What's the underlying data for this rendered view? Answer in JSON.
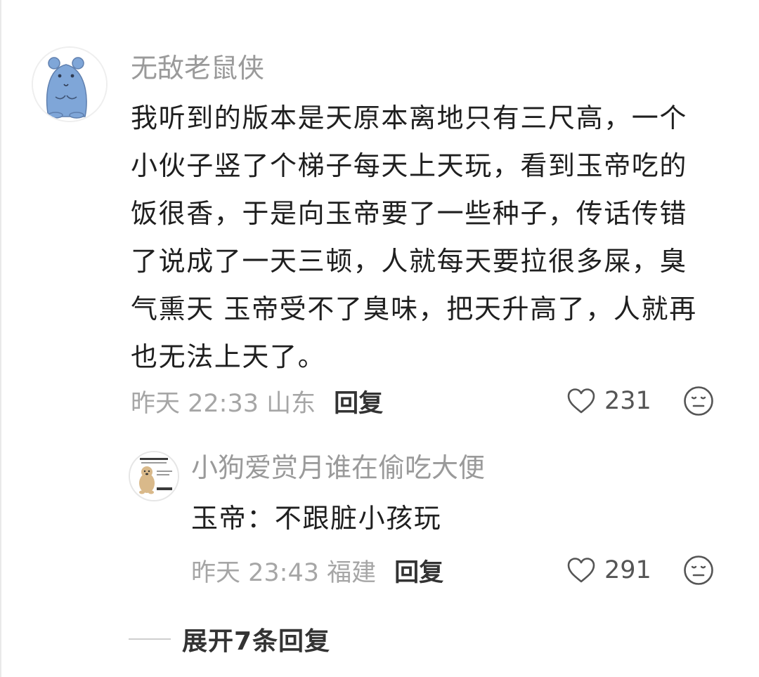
{
  "comment": {
    "username": "无敌老鼠侠",
    "avatar_icon": "mouse-avatar",
    "text": "我听到的版本是天原本离地只有三尺高，一个\n小伙子竖了个梯子每天上天玩，看到玉帝吃的\n饭很香，于是向玉帝要了一些种子，传话传错\n了说成了一天三顿，人就每天要拉很多屎，臭\n气熏天 玉帝受不了臭味，把天升高了，人就再\n也无法上天了。",
    "time_location": "昨天 22:33 山东",
    "reply_label": "回复",
    "likes": "231"
  },
  "reply": {
    "username": "小狗爱赏月谁在偷吃大便",
    "avatar_icon": "dog-meme-avatar",
    "text": "玉帝：不跟脏小孩玩",
    "time_location": "昨天 23:43 福建",
    "reply_label": "回复",
    "likes": "291"
  },
  "expand_label": "展开7条回复",
  "colors": {
    "username": "#9a9a9a",
    "content": "#1f1f1f",
    "meta": "#a6a6a6",
    "avatar_mouse": "#7fa6d8"
  }
}
